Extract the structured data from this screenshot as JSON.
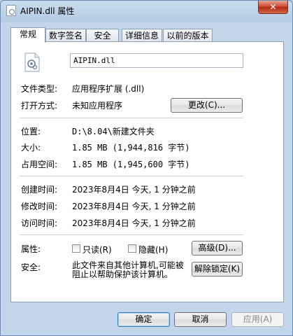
{
  "window": {
    "title": "AIPIN.dll 属性",
    "close_glyph": "✕"
  },
  "tabs": [
    {
      "label": "常规",
      "active": true
    },
    {
      "label": "数字签名"
    },
    {
      "label": "安全"
    },
    {
      "label": "详细信息"
    },
    {
      "label": "以前的版本"
    }
  ],
  "file": {
    "icon": "dll-file-icon",
    "name": "AIPIN.dll"
  },
  "props": {
    "type_label": "文件类型:",
    "type_value": "应用程序扩展 (.dll)",
    "open_label": "打开方式:",
    "open_value": "未知应用程序",
    "change_button": "更改(C)...",
    "location_label": "位置:",
    "location_value": "D:\\8.04\\新建文件夹",
    "size_label": "大小:",
    "size_value": "1.85 MB (1,944,816 字节)",
    "disk_label": "占用空间:",
    "disk_value": "1.85 MB (1,945,600 字节)",
    "created_label": "创建时间:",
    "created_value": "2023年8月4日 今天, 1 分钟之前",
    "modified_label": "修改时间:",
    "modified_value": "2023年8月4日 今天, 1 分钟之前",
    "accessed_label": "访问时间:",
    "accessed_value": "2023年8月4日 今天, 1 分钟之前",
    "attr_label": "属性:",
    "readonly_label": "只读(R)",
    "hidden_label": "隐藏(H)",
    "advanced_button": "高级(D)...",
    "readonly_checked": false,
    "hidden_checked": false,
    "security_label": "安全:",
    "security_text": "此文件来自其他计算机,可能被阻止以帮助保护该计算机。",
    "unblock_button": "解除锁定(K)"
  },
  "buttons": {
    "ok": "确定",
    "cancel": "取消",
    "apply": "应用(A)"
  }
}
